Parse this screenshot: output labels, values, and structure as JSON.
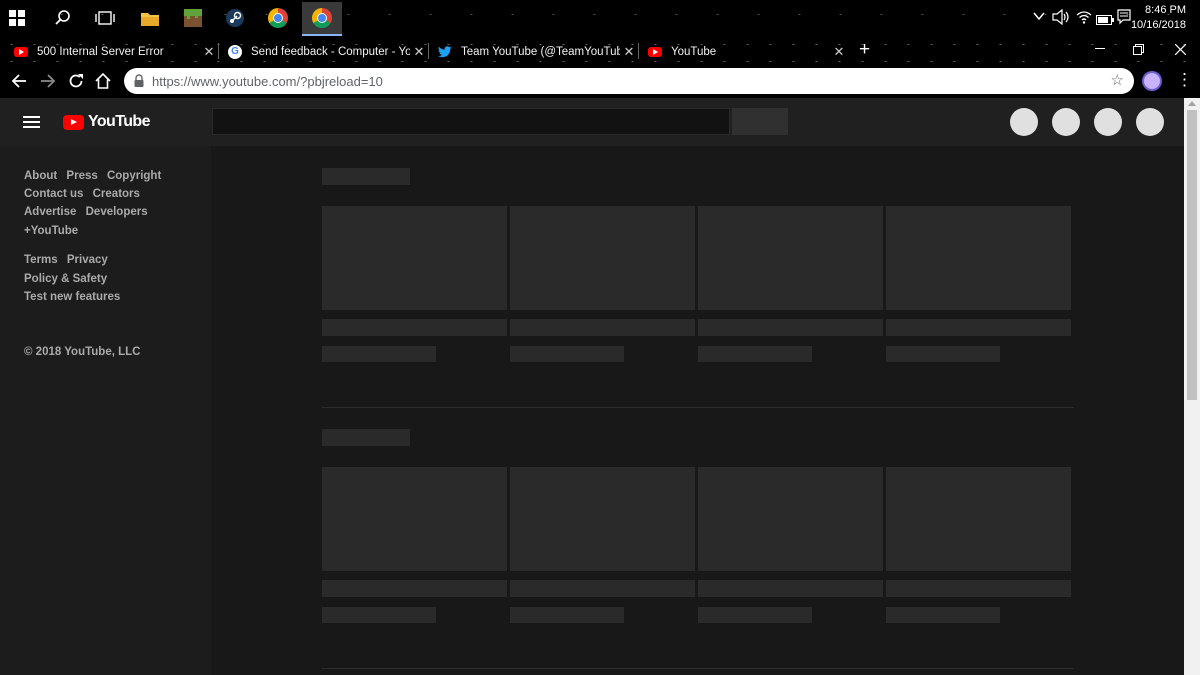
{
  "taskbar": {
    "clock_time": "8:46 PM",
    "clock_date": "10/16/2018"
  },
  "tabs": [
    {
      "title": "500 Internal Server Error",
      "favicon": "youtube-icon"
    },
    {
      "title": "Send feedback - Computer - You",
      "favicon": "google-icon"
    },
    {
      "title": "Team YouTube (@TeamYouTube)",
      "favicon": "twitter-icon"
    },
    {
      "title": "YouTube",
      "favicon": "youtube-icon"
    }
  ],
  "tab_close_glyph": "✕",
  "new_tab_glyph": "+",
  "omnibox": {
    "url": "https://www.youtube.com/?pbjreload=10"
  },
  "youtube": {
    "logo_text": "YouTube",
    "guide_links_1": [
      "About",
      "Press",
      "Copyright"
    ],
    "guide_links_2": [
      "Contact us",
      "Creators"
    ],
    "guide_links_3": [
      "Advertise",
      "Developers"
    ],
    "guide_links_4": [
      "+YouTube"
    ],
    "guide_links_5": [
      "Terms",
      "Privacy"
    ],
    "guide_links_6": [
      "Policy & Safety"
    ],
    "guide_links_7": [
      "Test new features"
    ],
    "copyright": "© 2018 YouTube, LLC"
  },
  "colors": {
    "page_bg": "#181818",
    "masthead_bg": "#202020",
    "placeholder": "#2a2a2a",
    "brand_red": "#ff0000"
  }
}
